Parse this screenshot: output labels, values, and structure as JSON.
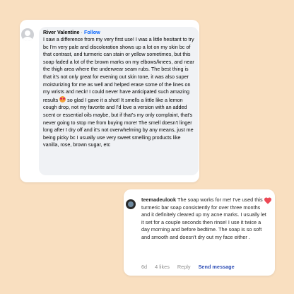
{
  "colors": {
    "background": "#f9dfc0",
    "card": "#ffffff",
    "fb_bubble": "#f0f2f5",
    "fb_link": "#0866ff",
    "ig_heart": "#ed4956",
    "ig_send": "#2f4fb6"
  },
  "facebook_comment": {
    "author": "River Valentine",
    "separator": "·",
    "follow_label": "Follow",
    "text_before_emoji": "I saw a difference from my very first use! I was a little hesitant to try bc I'm very pale and discoloration shows up a lot on my skin bc of that contrast, and turmeric can stain or yellow sometimes, but this soap faded a lot of the brown marks on my elbows/knees, and near the thigh area where the underwear seam rubs. The best thing is that it's not only great for evening out skin tone, it was also super moisturizing for me as well and helped erase some of the lines on my wrists and neck! I could never have anticipated such amazing results",
    "emoji": "heart-eyes-emoji",
    "text_after_emoji": " so glad I gave it a shot! It smells a little like a lemon cough drop, not my favorite and I'd love a version with an added scent or essential oils maybe, but if that's my only complaint, that's never going to stop me from buying more! The smell doesn't linger long after I dry off and it's not overwhelming by any means, just me being picky bc I usually use very sweet smelling products like vanilla, rose, brown sugar, etc",
    "avatar_icon": "default-avatar-icon"
  },
  "instagram_comment": {
    "username": "teemadeulook",
    "text": "The soap works for me! I've used this turmeric bar soap consistently for over three months and it definitely cleared up my acne marks. I usually let it set for a couple seconds then rinse! I use it twice a day morning and before bedtime. The soap is so soft and smooth and doesn't dry out my face either .",
    "time": "6d",
    "likes": "4 likes",
    "reply_label": "Reply",
    "send_label": "Send message",
    "like_icon": "heart-icon",
    "liked": true
  }
}
